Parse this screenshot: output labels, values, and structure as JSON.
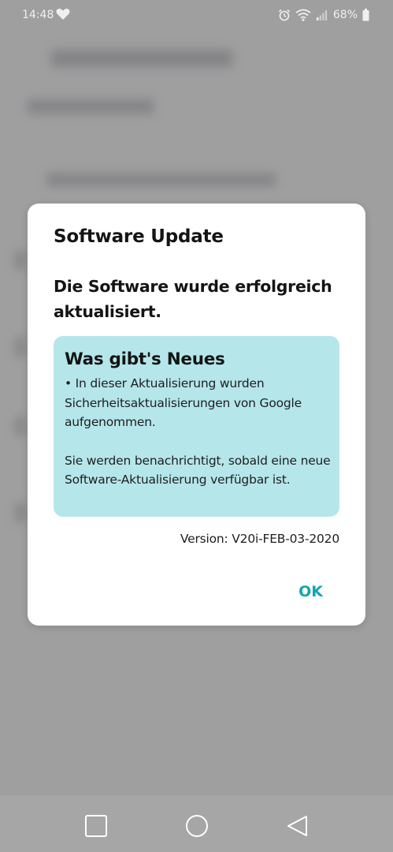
{
  "status_bar": {
    "time": "14:48",
    "battery_percent": "68%",
    "icons": [
      "heart-icon",
      "alarm-icon",
      "wifi-icon",
      "cellular-signal-icon",
      "battery-icon"
    ]
  },
  "dialog": {
    "title": "Software Update",
    "message": "Die Software wurde erfolgreich aktualisiert.",
    "whats_new": {
      "heading": "Was gibt's Neues",
      "bullet": "• In dieser Aktualisierung wurden Sicherheitsaktualisierungen von Google aufgenommen.",
      "note": "Sie werden benachrichtigt, sobald eine neue Software-Aktualisierung verfügbar ist."
    },
    "version": "Version: V20i-FEB-03-2020",
    "ok_label": "OK"
  },
  "colors": {
    "accent": "#12a4b4",
    "info_box": "#b5e6ea",
    "backdrop": "#a9a9aa"
  },
  "navigation_bar": {
    "icons": [
      "recents-square-icon",
      "home-circle-icon",
      "back-triangle-icon"
    ]
  }
}
